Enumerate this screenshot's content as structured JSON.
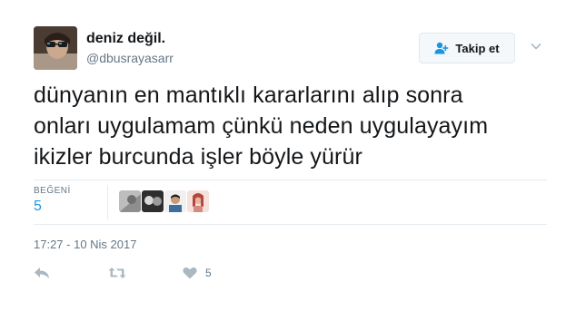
{
  "user": {
    "display_name": "deniz değil.",
    "username": "@dbusrayasarr"
  },
  "follow_button": {
    "label": "Takip et"
  },
  "tweet": {
    "lines": [
      "dünyanın en mantıklı kararlarını alıp sonra",
      "onları uygulamam çünkü neden uygulayayım",
      "ikizler burcunda işler böyle yürür"
    ]
  },
  "stats": {
    "likes_label": "BEĞENİ",
    "likes_count": "5"
  },
  "timestamp": "17:27 - 10 Nis 2017",
  "actions": {
    "like_count": "5"
  },
  "icons": {
    "follow": "add-user-icon",
    "menu": "chevron-down-icon",
    "reply": "reply-icon",
    "retweet": "retweet-icon",
    "like": "heart-icon"
  },
  "colors": {
    "link_blue": "#1b95e0",
    "muted": "#657786",
    "action_gray": "#aab8c2"
  }
}
